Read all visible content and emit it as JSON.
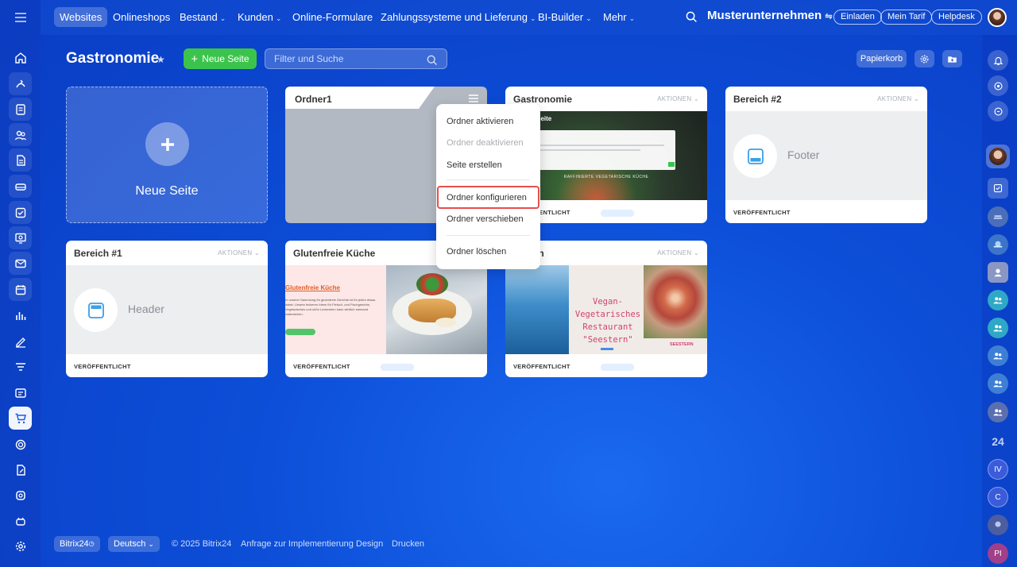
{
  "topbar": {
    "tabs": [
      {
        "label": "Websites",
        "chevron": false
      },
      {
        "label": "Onlineshops",
        "chevron": false
      },
      {
        "label": "Bestand",
        "chevron": true
      },
      {
        "label": "Kunden",
        "chevron": true
      },
      {
        "label": "Online-Formulare",
        "chevron": false
      },
      {
        "label": "Zahlungssysteme und Lieferung",
        "chevron": true
      },
      {
        "label": "BI-Builder",
        "chevron": true
      },
      {
        "label": "Mehr",
        "chevron": true
      }
    ],
    "company": "Musterunternehmen",
    "invite": "Einladen",
    "plan": "Mein Tarif",
    "helpdesk": "Helpdesk"
  },
  "header": {
    "title": "Gastronomie",
    "new_page_button": "Neue Seite",
    "search_placeholder": "Filter und Suche",
    "trash_button": "Papierkorb"
  },
  "cards": {
    "new_page": {
      "label": "Neue Seite"
    },
    "folder": {
      "title": "Ordner1"
    },
    "gastronomie": {
      "title": "Gastronomie",
      "actions": "AKTIONEN",
      "status": "VERÖFFENTLICHT",
      "preview_line1": "seite",
      "preview_line2": "RAFFINIERTE VEGETARISCHE KÜCHE"
    },
    "bereich2": {
      "title": "Bereich #2",
      "actions": "AKTIONEN",
      "placeholder": "Footer",
      "status": "VERÖFFENTLICHT"
    },
    "bereich1": {
      "title": "Bereich #1",
      "actions": "AKTIONEN",
      "placeholder": "Header",
      "status": "VERÖFFENTLICHT"
    },
    "glutenfrei": {
      "title": "Glutenfreie Küche",
      "status": "VERÖFFENTLICHT",
      "preview_heading": "Glutenfreie Küche",
      "preview_text": "In unserer Sammlung für glutenfreie Gerichte ist für jeden etwas dabei. Unsere leckeren Ideen für Fleisch- und Fischgerichte, Vegetarisches und süße Leckereien kann wirklich niemand widerstehen."
    },
    "unternehmen": {
      "title": "ehmen",
      "actions": "AKTIONEN",
      "status": "VERÖFFENTLICHT",
      "preview_heading": "Vegan-Vegetarisches Restaurant \"Seestern\"",
      "preview_small": "SEESTERN"
    }
  },
  "menu": {
    "activate": "Ordner aktivieren",
    "deactivate": "Ordner deaktivieren",
    "create_page": "Seite erstellen",
    "configure": "Ordner konfigurieren",
    "move": "Ordner verschieben",
    "delete": "Ordner löschen"
  },
  "footer": {
    "brand": "Bitrix24",
    "language": "Deutsch",
    "copyright": "© 2025 Bitrix24",
    "implementation": "Anfrage zur Implementierung",
    "design": "Design",
    "print": "Drucken"
  },
  "rightbar": {
    "count24": "24",
    "iv": "IV",
    "c": "C",
    "pi": "PI"
  },
  "colors": {
    "accent_green": "#3bc44b",
    "highlight_red": "#e84d4d",
    "glutenfrei_heading": "#e35d20",
    "seestern_heading": "#d0436f"
  }
}
